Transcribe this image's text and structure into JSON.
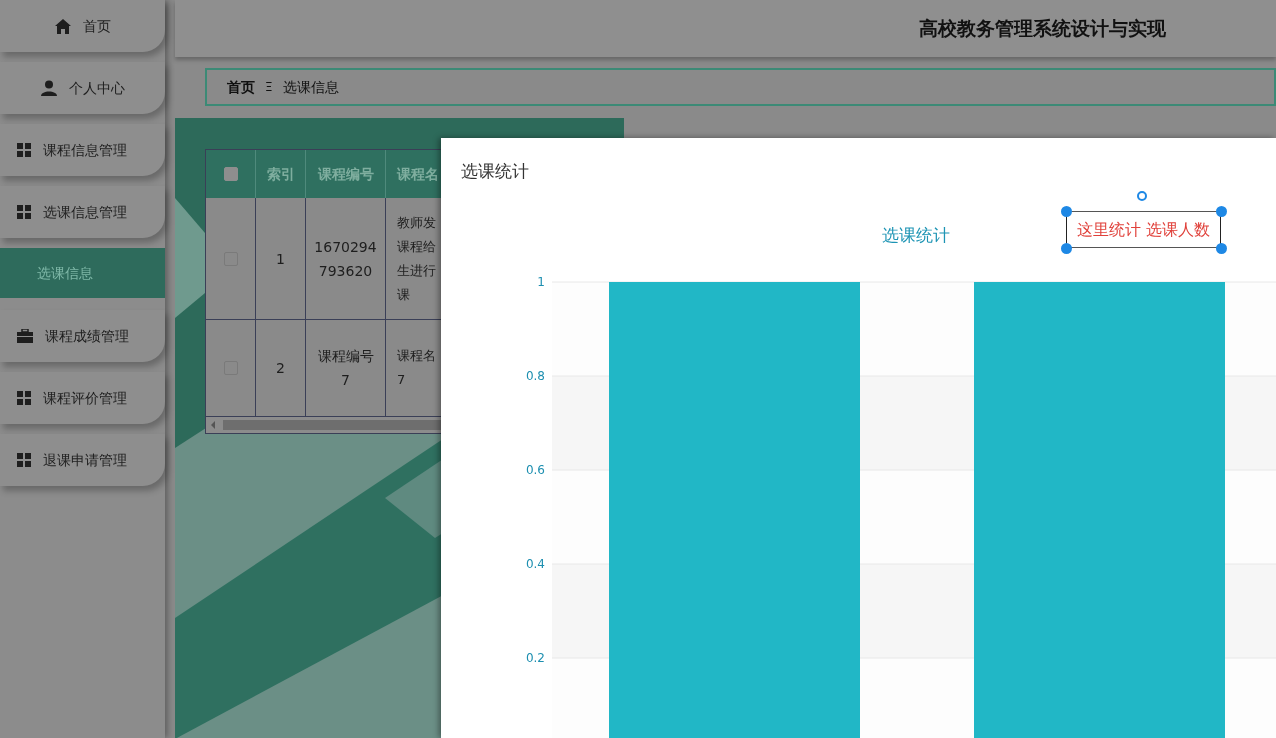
{
  "header": {
    "title": "高校教务管理系统设计与实现"
  },
  "sidebar": {
    "items": [
      {
        "label": "首页",
        "kind": "top",
        "selected": false
      },
      {
        "label": "个人中心",
        "kind": "top",
        "selected": false
      },
      {
        "label": "课程信息管理",
        "kind": "menu",
        "selected": false
      },
      {
        "label": "选课信息管理",
        "kind": "menu",
        "selected": false
      },
      {
        "label": "选课信息",
        "kind": "submenu",
        "selected": true
      },
      {
        "label": "课程成绩管理",
        "kind": "menu",
        "selected": false
      },
      {
        "label": "课程评价管理",
        "kind": "menu",
        "selected": false
      },
      {
        "label": "退课申请管理",
        "kind": "menu",
        "selected": false
      }
    ]
  },
  "breadcrumb": {
    "items": [
      "首页",
      "选课信息"
    ],
    "separator": "Ξ"
  },
  "table": {
    "select_all": {
      "checked": false
    },
    "columns": [
      "索引",
      "课程编号",
      "课程名"
    ],
    "rows": [
      {
        "checked": false,
        "cells": [
          [
            "1"
          ],
          [
            "1670294",
            "793620"
          ],
          [
            "教师发",
            "课程给",
            "生进行",
            "课"
          ]
        ]
      },
      {
        "checked": false,
        "cells": [
          [
            "2"
          ],
          [
            "课程编号",
            "7"
          ],
          [
            "课程名",
            "7"
          ]
        ]
      }
    ]
  },
  "dialog": {
    "title": "选课统计",
    "chart_data": {
      "type": "bar",
      "grid": true,
      "title": "选课统计",
      "values": [
        1,
        1
      ],
      "ylim": [
        0,
        1
      ],
      "yticks": [
        0.2,
        0.4,
        0.6,
        0.8,
        1
      ]
    },
    "annotation": {
      "text": "这里统计 选课人数"
    }
  }
}
